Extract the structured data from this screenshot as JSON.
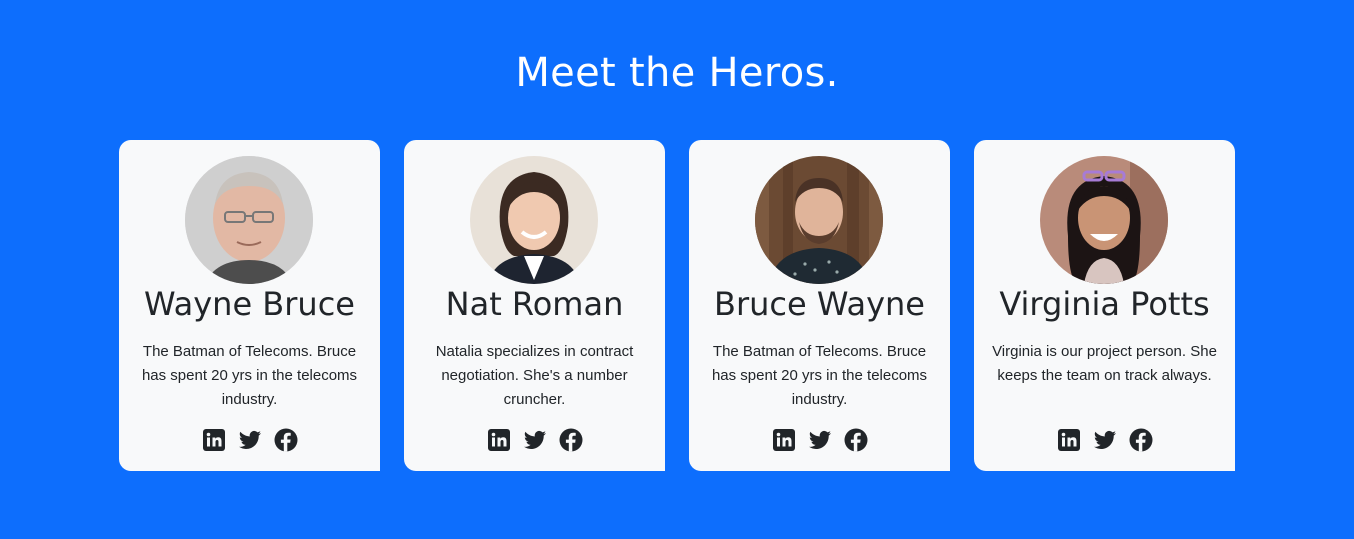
{
  "section": {
    "title": "Meet the Heros."
  },
  "colors": {
    "background": "#0d6efd",
    "card": "#f8f9fa",
    "text": "#212529"
  },
  "heroes": [
    {
      "name": "Wayne Bruce",
      "bio": "The Batman of Telecoms. Bruce has spent 20 yrs in the telecoms industry.",
      "socials": [
        "linkedin-icon",
        "twitter-icon",
        "facebook-icon"
      ]
    },
    {
      "name": "Nat Roman",
      "bio": "Natalia specializes in contract negotiation. She's a number cruncher.",
      "socials": [
        "linkedin-icon",
        "twitter-icon",
        "facebook-icon"
      ]
    },
    {
      "name": "Bruce Wayne",
      "bio": "The Batman of Telecoms. Bruce has spent 20 yrs in the telecoms industry.",
      "socials": [
        "linkedin-icon",
        "twitter-icon",
        "facebook-icon"
      ]
    },
    {
      "name": "Virginia Potts",
      "bio": "Virginia is our project person. She keeps the team on track always.",
      "socials": [
        "linkedin-icon",
        "twitter-icon",
        "facebook-icon"
      ]
    }
  ]
}
